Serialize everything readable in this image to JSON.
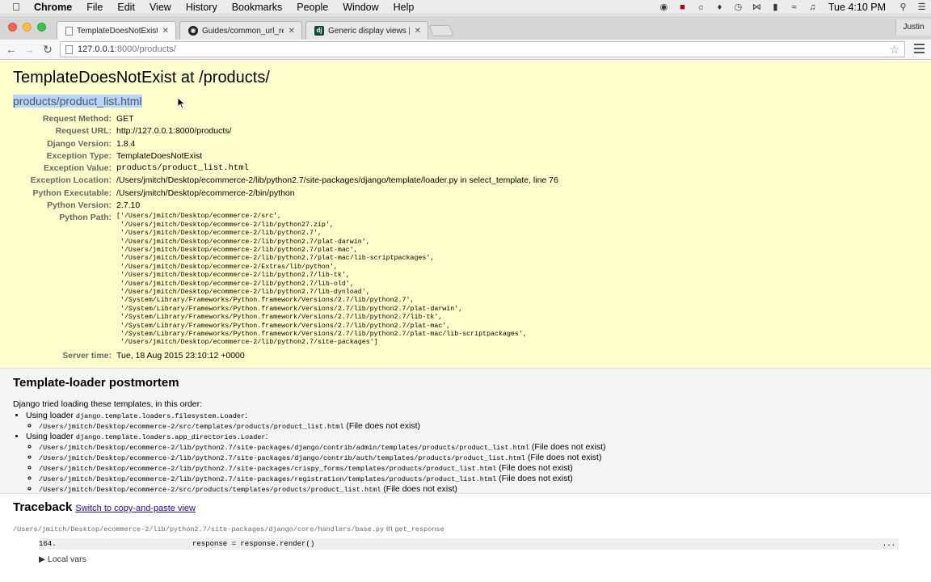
{
  "menubar": {
    "app_name": "Chrome",
    "menus": [
      "File",
      "Edit",
      "View",
      "History",
      "Bookmarks",
      "People",
      "Window",
      "Help"
    ],
    "clock": "Tue 4:10 PM"
  },
  "tabs": [
    {
      "title": "TemplateDoesNotExist at /",
      "active": true
    },
    {
      "title": "Guides/common_url_regex",
      "active": false
    },
    {
      "title": "Generic display views | Dja",
      "active": false
    }
  ],
  "profile_name": "Justin",
  "address_bar": {
    "host": "127.0.0.1",
    "path": ":8000/products/"
  },
  "error": {
    "title": "TemplateDoesNotExist at /products/",
    "exception_value_heading": "products/product_list.html",
    "meta": [
      {
        "label": "Request Method:",
        "value": "GET"
      },
      {
        "label": "Request URL:",
        "value": "http://127.0.0.1:8000/products/"
      },
      {
        "label": "Django Version:",
        "value": "1.8.4"
      },
      {
        "label": "Exception Type:",
        "value": "TemplateDoesNotExist"
      },
      {
        "label": "Exception Value:",
        "value": "products/product_list.html",
        "mono": true
      },
      {
        "label": "Exception Location:",
        "value": "/Users/jmitch/Desktop/ecommerce-2/lib/python2.7/site-packages/django/template/loader.py in select_template, line 76"
      },
      {
        "label": "Python Executable:",
        "value": "/Users/jmitch/Desktop/ecommerce-2/bin/python"
      },
      {
        "label": "Python Version:",
        "value": "2.7.10"
      }
    ],
    "python_path_label": "Python Path:",
    "python_path": "['/Users/jmitch/Desktop/ecommerce-2/src',\n '/Users/jmitch/Desktop/ecommerce-2/lib/python27.zip',\n '/Users/jmitch/Desktop/ecommerce-2/lib/python2.7',\n '/Users/jmitch/Desktop/ecommerce-2/lib/python2.7/plat-darwin',\n '/Users/jmitch/Desktop/ecommerce-2/lib/python2.7/plat-mac',\n '/Users/jmitch/Desktop/ecommerce-2/lib/python2.7/plat-mac/lib-scriptpackages',\n '/Users/jmitch/Desktop/ecommerce-2/Extras/lib/python',\n '/Users/jmitch/Desktop/ecommerce-2/lib/python2.7/lib-tk',\n '/Users/jmitch/Desktop/ecommerce-2/lib/python2.7/lib-old',\n '/Users/jmitch/Desktop/ecommerce-2/lib/python2.7/lib-dynload',\n '/System/Library/Frameworks/Python.framework/Versions/2.7/lib/python2.7',\n '/System/Library/Frameworks/Python.framework/Versions/2.7/lib/python2.7/plat-darwin',\n '/System/Library/Frameworks/Python.framework/Versions/2.7/lib/python2.7/lib-tk',\n '/System/Library/Frameworks/Python.framework/Versions/2.7/lib/python2.7/plat-mac',\n '/System/Library/Frameworks/Python.framework/Versions/2.7/lib/python2.7/plat-mac/lib-scriptpackages',\n '/Users/jmitch/Desktop/ecommerce-2/lib/python2.7/site-packages']",
    "server_time_label": "Server time:",
    "server_time": "Tue, 18 Aug 2015 23:10:12 +0000"
  },
  "postmortem": {
    "heading": "Template-loader postmortem",
    "intro": "Django tried loading these templates, in this order:",
    "loaders": [
      {
        "prefix": "Using loader ",
        "name": "django.template.loaders.filesystem.Loader",
        "suffix": ":",
        "entries": [
          {
            "path": "/Users/jmitch/Desktop/ecommerce-2/src/templates/products/product_list.html",
            "status": " (File does not exist)"
          }
        ]
      },
      {
        "prefix": "Using loader ",
        "name": "django.template.loaders.app_directories.Loader",
        "suffix": ":",
        "entries": [
          {
            "path": "/Users/jmitch/Desktop/ecommerce-2/lib/python2.7/site-packages/django/contrib/admin/templates/products/product_list.html",
            "status": " (File does not exist)"
          },
          {
            "path": "/Users/jmitch/Desktop/ecommerce-2/lib/python2.7/site-packages/django/contrib/auth/templates/products/product_list.html",
            "status": " (File does not exist)"
          },
          {
            "path": "/Users/jmitch/Desktop/ecommerce-2/lib/python2.7/site-packages/crispy_forms/templates/products/product_list.html",
            "status": " (File does not exist)"
          },
          {
            "path": "/Users/jmitch/Desktop/ecommerce-2/lib/python2.7/site-packages/registration/templates/products/product_list.html",
            "status": " (File does not exist)"
          },
          {
            "path": "/Users/jmitch/Desktop/ecommerce-2/src/products/templates/products/product_list.html",
            "status": " (File does not exist)"
          }
        ]
      }
    ]
  },
  "traceback": {
    "heading": "Traceback",
    "switch_link": "Switch to copy-and-paste view",
    "frame_file": "/Users/jmitch/Desktop/ecommerce-2/lib/python2.7/site-packages/django/core/handlers/base.py",
    "frame_in": " in ",
    "frame_func": "get_response",
    "line_number": "164.",
    "line_code": "response = response.render()",
    "ellipsis": "...",
    "local_vars": "Local vars"
  }
}
